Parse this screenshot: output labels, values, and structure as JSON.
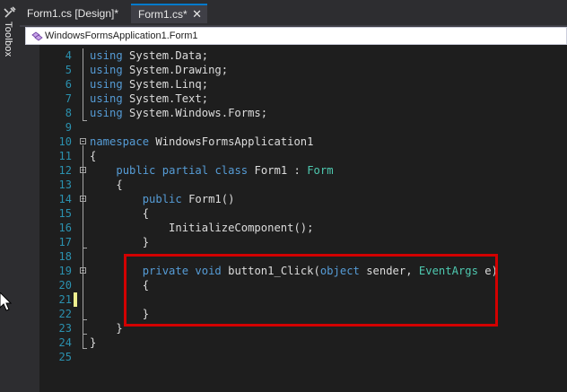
{
  "toolbox": {
    "label": "Toolbox",
    "icon": "toolbox-icon"
  },
  "tabs": [
    {
      "label": "Form1.cs [Design]*",
      "active": false
    },
    {
      "label": "Form1.cs*",
      "active": true,
      "close": "✕"
    }
  ],
  "navbar": {
    "class_label": "WindowsFormsApplication1.Form1",
    "icon": "class-icon"
  },
  "editor": {
    "lines": [
      {
        "n": "4",
        "code": "using System.Data;"
      },
      {
        "n": "5",
        "code": "using System.Drawing;"
      },
      {
        "n": "6",
        "code": "using System.Linq;"
      },
      {
        "n": "7",
        "code": "using System.Text;"
      },
      {
        "n": "8",
        "code": "using System.Windows.Forms;"
      },
      {
        "n": "9",
        "code": ""
      },
      {
        "n": "10",
        "code": "namespace WindowsFormsApplication1"
      },
      {
        "n": "11",
        "code": "{"
      },
      {
        "n": "12",
        "code": "    public partial class Form1 : Form"
      },
      {
        "n": "13",
        "code": "    {"
      },
      {
        "n": "14",
        "code": "        public Form1()"
      },
      {
        "n": "15",
        "code": "        {"
      },
      {
        "n": "16",
        "code": "            InitializeComponent();"
      },
      {
        "n": "17",
        "code": "        }"
      },
      {
        "n": "18",
        "code": ""
      },
      {
        "n": "19",
        "code": "        private void button1_Click(object sender, EventArgs e)"
      },
      {
        "n": "20",
        "code": "        {"
      },
      {
        "n": "21",
        "code": ""
      },
      {
        "n": "22",
        "code": "        }"
      },
      {
        "n": "23",
        "code": "    }"
      },
      {
        "n": "24",
        "code": "}"
      },
      {
        "n": "25",
        "code": ""
      }
    ]
  },
  "colors": {
    "keyword": "#569cd6",
    "type": "#4ec9b0",
    "line_number": "#2b91af",
    "highlight": "#d20000"
  }
}
